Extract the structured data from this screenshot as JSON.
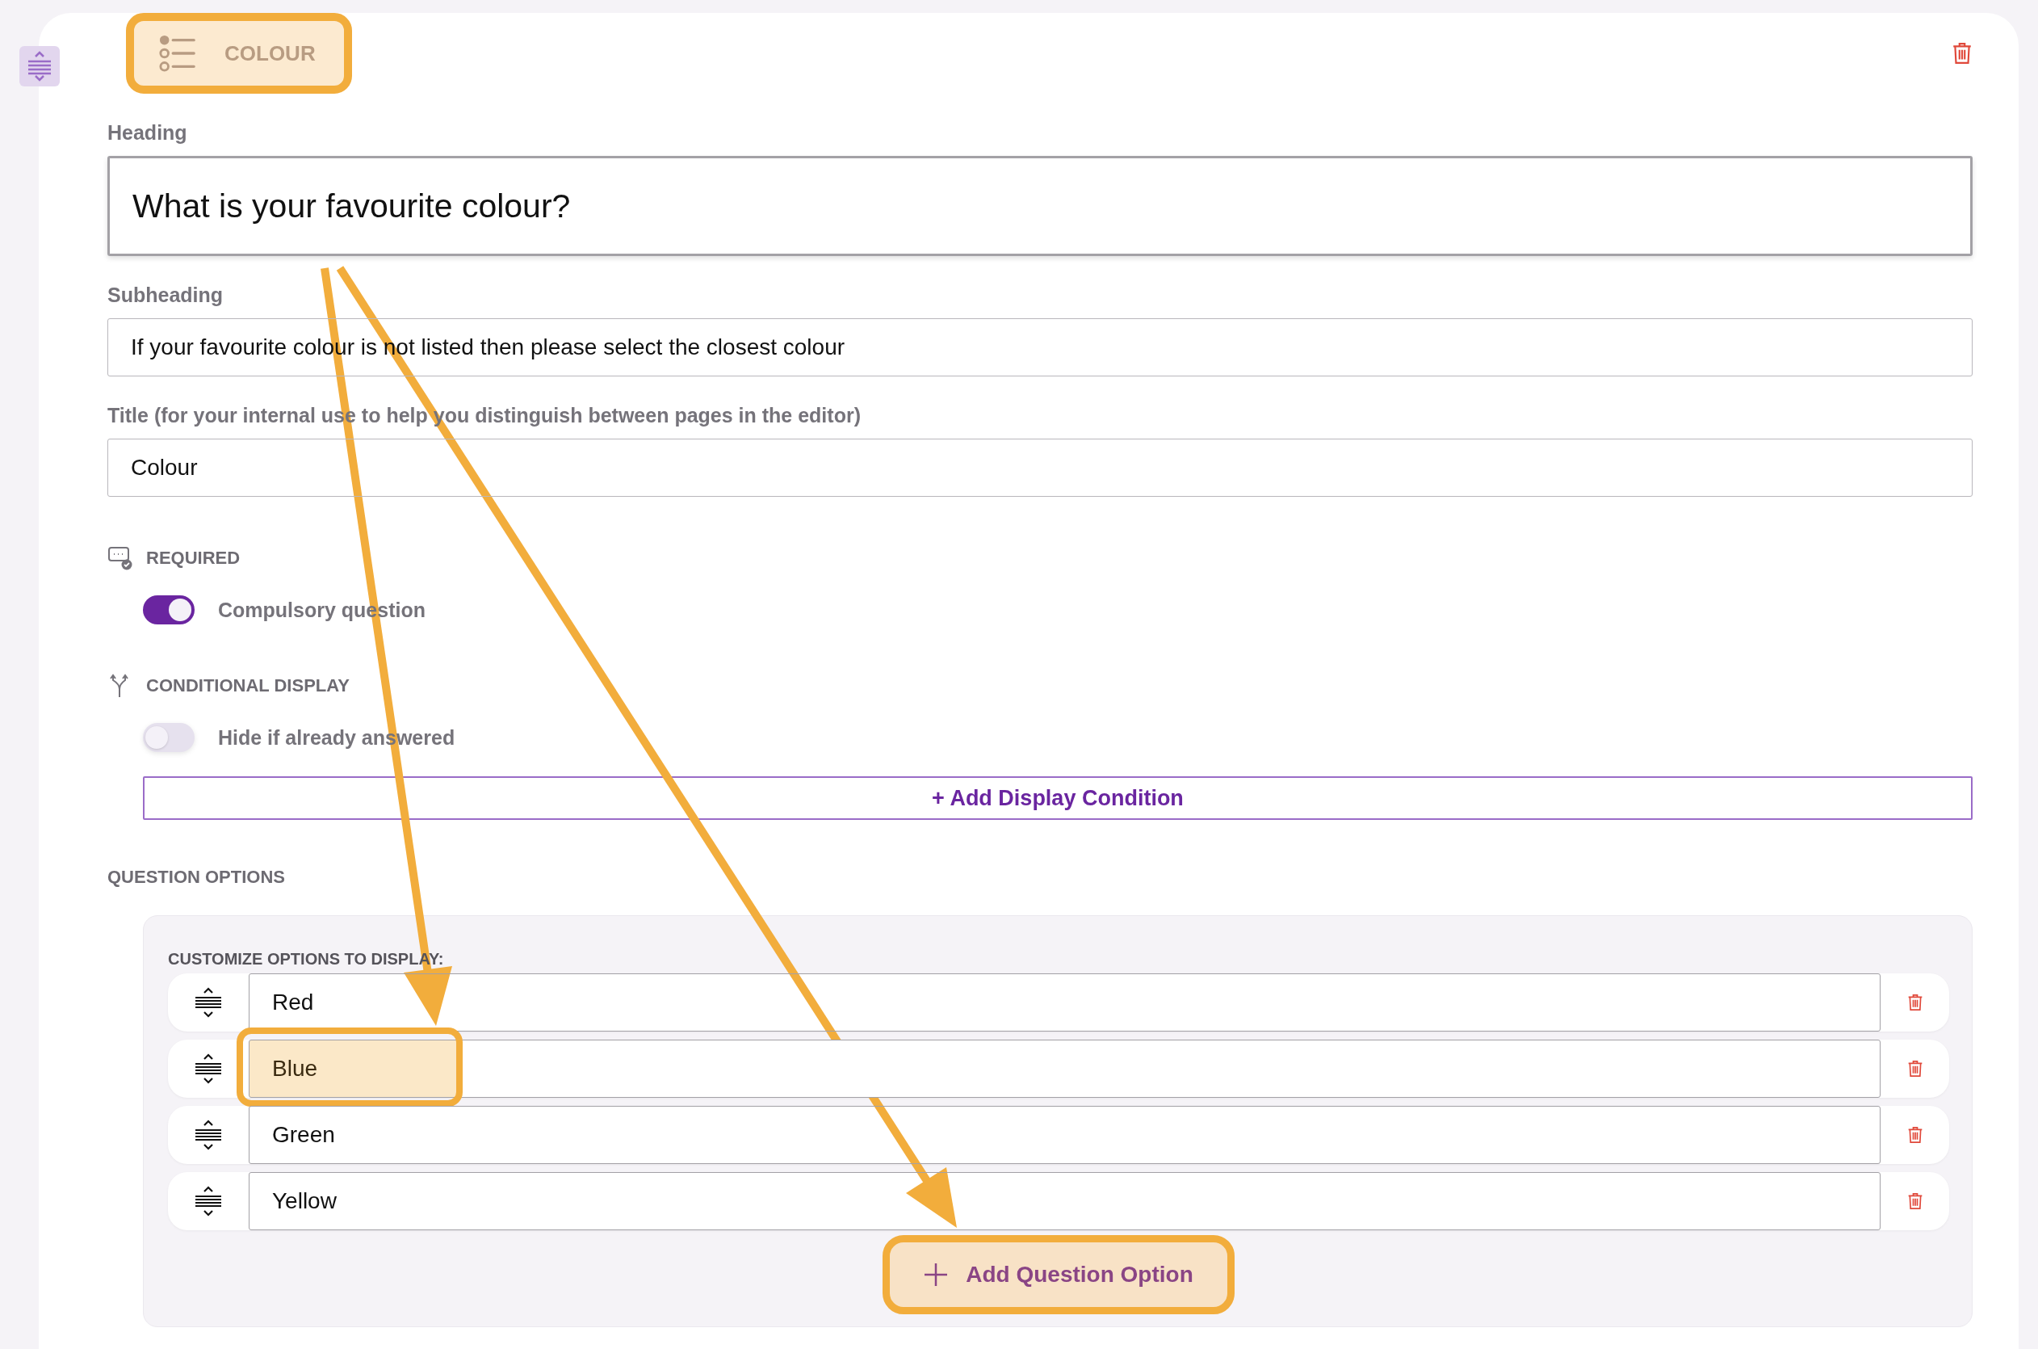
{
  "page_type": {
    "label": "COLOUR",
    "highlighted": true
  },
  "fields": [
    {
      "label": "Heading",
      "value": "What is your favourite colour?",
      "kind": "large"
    },
    {
      "label": "Subheading",
      "value": "If your favourite colour is not listed then please select the closest colour",
      "kind": "normal"
    },
    {
      "label": "Title (for your internal use to help you distinguish between pages in the editor)",
      "value": "Colour",
      "kind": "normal"
    }
  ],
  "settings": [
    {
      "kind": "required",
      "heading": "REQUIRED",
      "toggle": {
        "label": "Compulsory question",
        "on": true
      }
    },
    {
      "kind": "conditional",
      "heading": "CONDITIONAL DISPLAY",
      "toggle": {
        "label": "Hide if already answered",
        "on": false
      },
      "button": "+ Add Display Condition"
    }
  ],
  "question_options": {
    "heading": "QUESTION OPTIONS",
    "subheading": "CUSTOMIZE OPTIONS TO DISPLAY:",
    "options": [
      {
        "value": "Red",
        "highlighted": false
      },
      {
        "value": "Blue",
        "highlighted": true
      },
      {
        "value": "Green",
        "highlighted": false
      },
      {
        "value": "Yellow",
        "highlighted": false
      }
    ],
    "add_button": {
      "label": "Add Question Option",
      "highlighted": true
    }
  }
}
